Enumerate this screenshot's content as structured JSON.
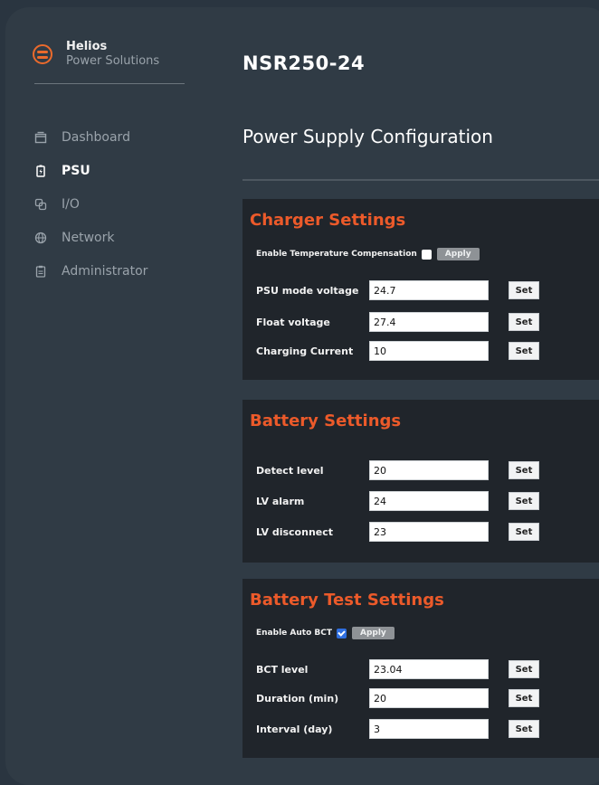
{
  "brand": {
    "name": "Helios",
    "subtitle": "Power Solutions"
  },
  "sidebar": {
    "items": [
      {
        "label": "Dashboard",
        "icon": "window-icon",
        "active": false
      },
      {
        "label": "PSU",
        "icon": "battery-icon",
        "active": true
      },
      {
        "label": "I/O",
        "icon": "io-icon",
        "active": false
      },
      {
        "label": "Network",
        "icon": "globe-icon",
        "active": false
      },
      {
        "label": "Administrator",
        "icon": "clipboard-icon",
        "active": false
      }
    ]
  },
  "main": {
    "device_title": "NSR250-24",
    "page_title": "Power Supply Configuration"
  },
  "charger": {
    "title": "Charger Settings",
    "enable_label": "Enable Temperature Compensation",
    "enable_checked": false,
    "apply_label": "Apply",
    "fields": [
      {
        "label": "PSU mode voltage",
        "value": "24.7",
        "button": "Set"
      },
      {
        "label": "Float voltage",
        "value": "27.4",
        "button": "Set"
      },
      {
        "label": "Charging Current",
        "value": "10",
        "button": "Set"
      }
    ]
  },
  "battery": {
    "title": "Battery Settings",
    "fields": [
      {
        "label": "Detect level",
        "value": "20",
        "button": "Set"
      },
      {
        "label": "LV alarm",
        "value": "24",
        "button": "Set"
      },
      {
        "label": "LV disconnect",
        "value": "23",
        "button": "Set"
      }
    ]
  },
  "battery_test": {
    "title": "Battery Test Settings",
    "enable_label": "Enable Auto BCT",
    "enable_checked": true,
    "apply_label": "Apply",
    "fields": [
      {
        "label": "BCT level",
        "value": "23.04",
        "button": "Set"
      },
      {
        "label": "Duration (min)",
        "value": "20",
        "button": "Set"
      },
      {
        "label": "Interval (day)",
        "value": "3",
        "button": "Set"
      }
    ]
  },
  "colors": {
    "accent": "#ec5a2a",
    "background": "#303b45",
    "card": "#20252b"
  }
}
